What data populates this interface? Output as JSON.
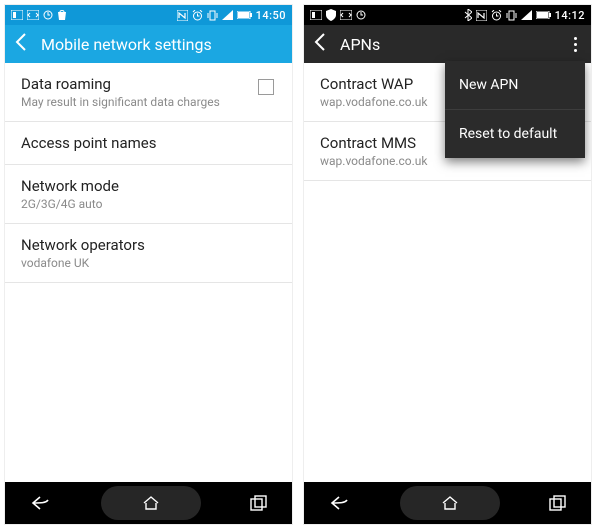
{
  "left": {
    "statusbar": {
      "time": "14:50"
    },
    "appbar": {
      "title": "Mobile network settings"
    },
    "rows": {
      "roaming": {
        "primary": "Data roaming",
        "secondary": "May result in significant data charges"
      },
      "apn": {
        "primary": "Access point names"
      },
      "mode": {
        "primary": "Network mode",
        "secondary": "2G/3G/4G auto"
      },
      "ops": {
        "primary": "Network operators",
        "secondary": "vodafone UK"
      }
    }
  },
  "right": {
    "statusbar": {
      "time": "14:12"
    },
    "appbar": {
      "title": "APNs"
    },
    "rows": {
      "wap": {
        "primary": "Contract WAP",
        "secondary": "wap.vodafone.co.uk"
      },
      "mms": {
        "primary": "Contract MMS",
        "secondary": "wap.vodafone.co.uk"
      }
    },
    "menu": {
      "new": "New APN",
      "reset": "Reset to default"
    }
  }
}
